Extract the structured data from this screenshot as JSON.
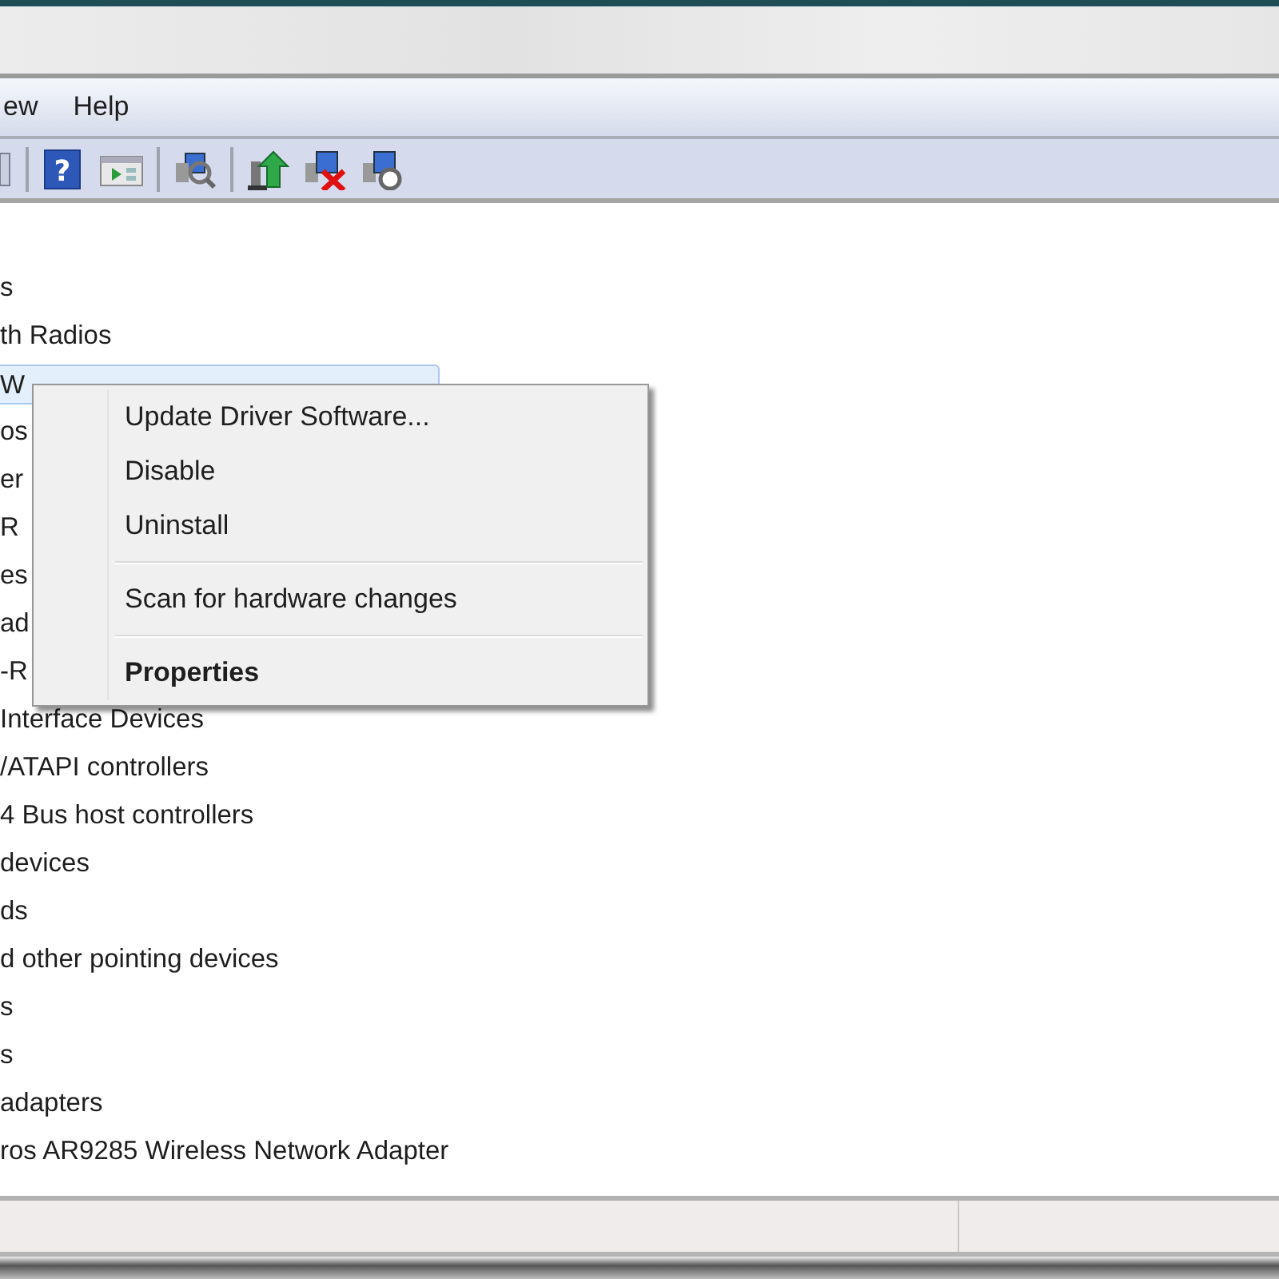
{
  "menubar": [
    {
      "label": "ew"
    },
    {
      "label": "Help"
    }
  ],
  "toolbar": [
    {
      "kind": "edge"
    },
    {
      "kind": "sep"
    },
    {
      "kind": "help",
      "glyph": "?"
    },
    {
      "kind": "console"
    },
    {
      "kind": "sep"
    },
    {
      "kind": "scan"
    },
    {
      "kind": "sep"
    },
    {
      "kind": "update"
    },
    {
      "kind": "uninstall"
    },
    {
      "kind": "rollback"
    }
  ],
  "tree": [
    {
      "label": "s",
      "selected": false
    },
    {
      "label": "th Radios",
      "selected": false
    },
    {
      "label": "W",
      "selected": true
    },
    {
      "label": "os",
      "selected": false
    },
    {
      "label": "er",
      "selected": false
    },
    {
      "label": "R",
      "selected": false
    },
    {
      "label": "es",
      "selected": false
    },
    {
      "label": "ad",
      "selected": false
    },
    {
      "label": "-R",
      "selected": false
    },
    {
      "label": "Interface Devices",
      "selected": false
    },
    {
      "label": "/ATAPI controllers",
      "selected": false
    },
    {
      "label": "4 Bus host controllers",
      "selected": false
    },
    {
      "label": "devices",
      "selected": false
    },
    {
      "label": "ds",
      "selected": false
    },
    {
      "label": "d other pointing devices",
      "selected": false
    },
    {
      "label": "s",
      "selected": false
    },
    {
      "label": "s",
      "selected": false
    },
    {
      "label": "adapters",
      "selected": false
    },
    {
      "label": "ros AR9285 Wireless Network Adapter",
      "selected": false
    }
  ],
  "context_menu": [
    {
      "kind": "item",
      "label": "Update Driver Software...",
      "default": false
    },
    {
      "kind": "item",
      "label": "Disable",
      "default": false
    },
    {
      "kind": "item",
      "label": "Uninstall",
      "default": false
    },
    {
      "kind": "separator"
    },
    {
      "kind": "item",
      "label": "Scan for hardware changes",
      "default": false
    },
    {
      "kind": "separator"
    },
    {
      "kind": "item",
      "label": "Properties",
      "default": true
    }
  ]
}
